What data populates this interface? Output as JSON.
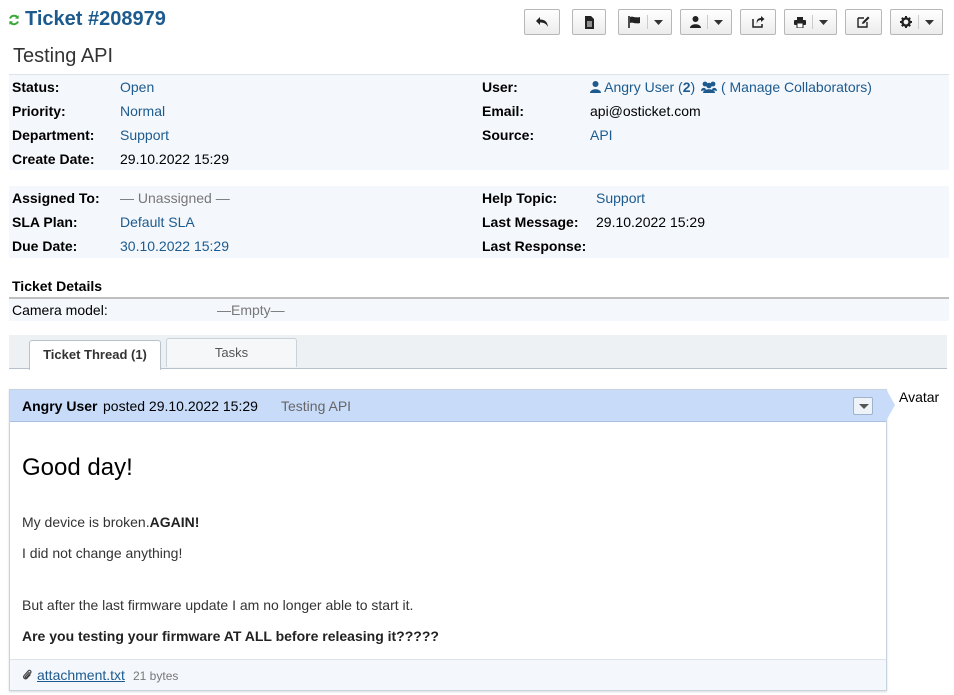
{
  "header": {
    "ticket_title": "Ticket #208979",
    "subject": "Testing API"
  },
  "info": {
    "status_label": "Status:",
    "status_value": "Open",
    "priority_label": "Priority:",
    "priority_value": "Normal",
    "department_label": "Department:",
    "department_value": "Support",
    "create_date_label": "Create Date:",
    "create_date_value": "29.10.2022 15:29",
    "user_label": "User:",
    "user_name": "Angry User",
    "user_count_open": " (",
    "user_count": "2",
    "user_count_close": ")",
    "manage_collaborators": "( Manage Collaborators)",
    "email_label": "Email:",
    "email_value": "api@osticket.com",
    "source_label": "Source:",
    "source_value": "API"
  },
  "assignment": {
    "assigned_label": "Assigned To:",
    "assigned_value": "— Unassigned —",
    "sla_label": "SLA Plan:",
    "sla_value": "Default SLA",
    "due_label": "Due Date:",
    "due_value": "30.10.2022 15:29",
    "help_topic_label": "Help Topic:",
    "help_topic_value": "Support",
    "last_message_label": "Last Message:",
    "last_message_value": "29.10.2022 15:29",
    "last_response_label": "Last Response:"
  },
  "details": {
    "title": "Ticket Details",
    "field_label": "Camera model:",
    "field_value": "—Empty—"
  },
  "tabs": [
    {
      "label": "Ticket Thread (1)"
    },
    {
      "label": "Tasks"
    }
  ],
  "thread": {
    "author": "Angry User",
    "posted": "posted 29.10.2022 15:29",
    "title": "Testing API",
    "avatar_label": "Avatar",
    "greeting": "Good day!",
    "line1_prefix": "My device is broken.",
    "line1_bold": "AGAIN!",
    "line2": "I did not change anything!",
    "line3": "But after the last firmware update I am no longer able to start it.",
    "line4": "Are you testing your firmware AT ALL before releasing it?????",
    "attachment_name": "attachment.txt",
    "attachment_size": "21 bytes"
  },
  "icons": {
    "refresh": "refresh-icon",
    "reply": "reply-icon",
    "note": "file-icon",
    "flag": "flag-icon",
    "user": "user-icon",
    "share": "share-icon",
    "print": "print-icon",
    "edit": "edit-icon",
    "settings": "gear-icon",
    "collaborators": "users-icon",
    "attachment": "paperclip-icon"
  },
  "colors": {
    "link": "#1d5b8f",
    "refresh": "#3ba83b",
    "thread_header": "#c8dcfa",
    "info_bg": "#f4f7fb"
  }
}
